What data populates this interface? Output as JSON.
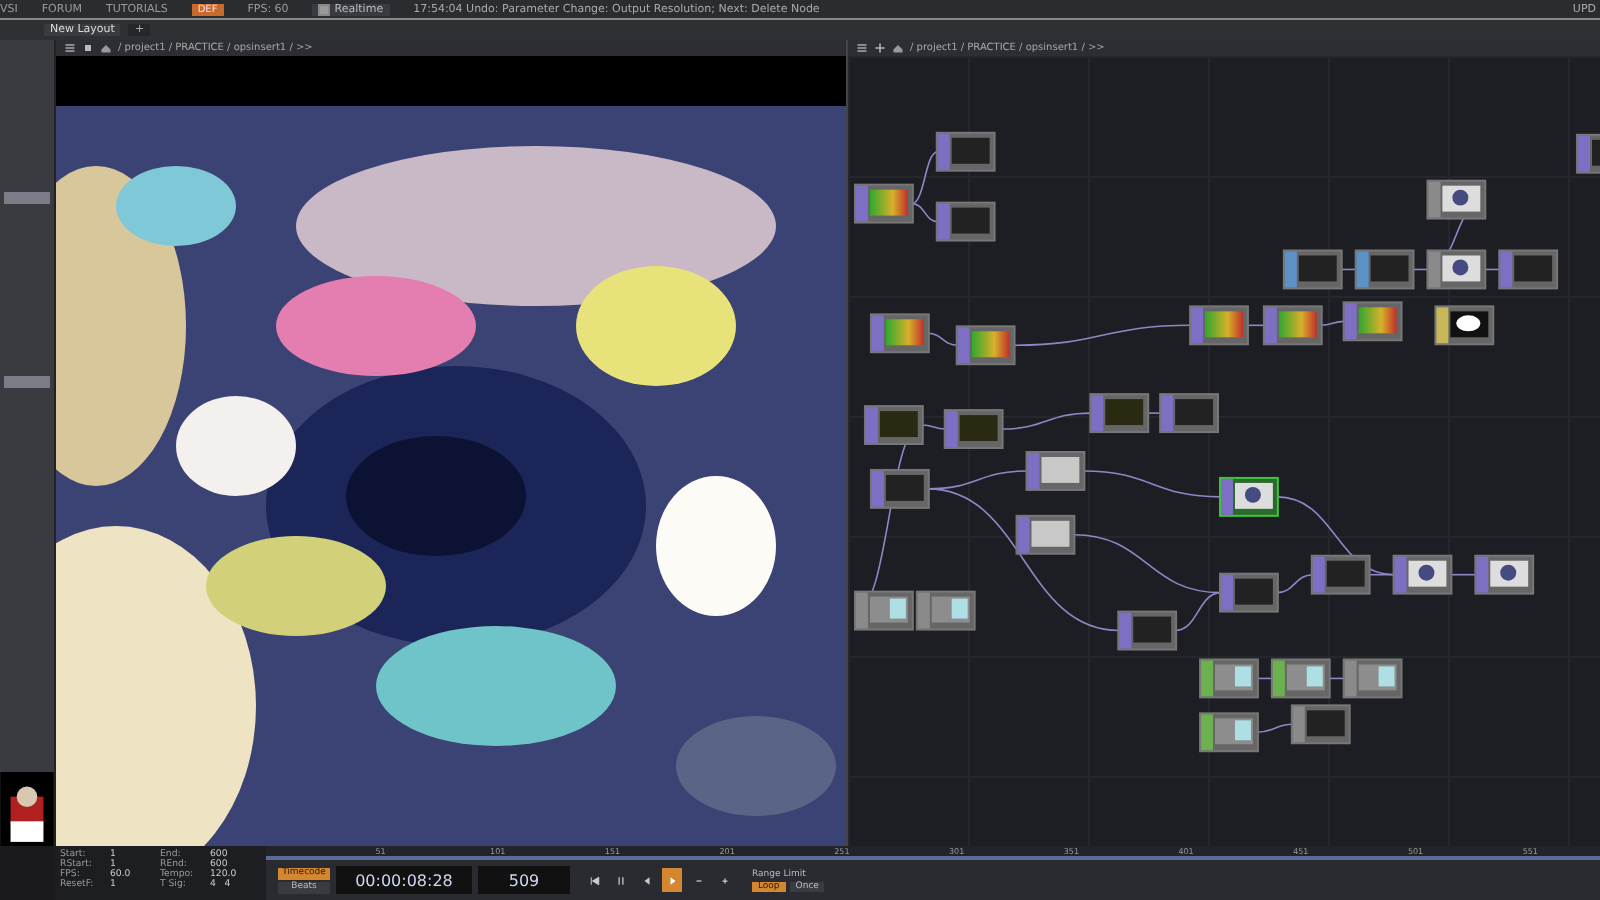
{
  "menubar": {
    "items": [
      "VSI",
      "FORUM",
      "TUTORIALS"
    ],
    "badge": "DEF",
    "fps": "FPS:  60",
    "realtime": {
      "label": "Realtime",
      "checked": true
    },
    "message": "17:54:04 Undo: Parameter Change: Output Resolution; Next: Delete Node",
    "right": "UPD"
  },
  "tabs": [
    {
      "label": "New Layout",
      "selected": true
    },
    {
      "label": "+",
      "selected": false
    }
  ],
  "viewer_path": "/ project1 / PRACTICE / opsinsert1 / >>",
  "network_path": "/ project1 / PRACTICE / opsinsert1 / >>",
  "nodes": [
    {
      "color": "#7d70c4",
      "kind": "gradient",
      "selected": false
    },
    {
      "color": "#7d70c4",
      "kind": "dark",
      "selected": false
    },
    {
      "color": "#7d70c4",
      "kind": "dark",
      "selected": false
    },
    {
      "color": "#7d70c4",
      "kind": "gradient",
      "selected": false
    },
    {
      "color": "#7d70c4",
      "kind": "gradient",
      "selected": false
    },
    {
      "color": "#7d70c4",
      "kind": "gradient",
      "selected": false
    },
    {
      "color": "#7d70c4",
      "kind": "gradient",
      "selected": false
    },
    {
      "color": "#7d70c4",
      "kind": "gradient",
      "selected": false
    },
    {
      "color": "#5b92c8",
      "kind": "dark",
      "selected": false
    },
    {
      "color": "#5b92c8",
      "kind": "dark",
      "selected": false
    },
    {
      "color": "#8a8a8a",
      "kind": "eye",
      "selected": false
    },
    {
      "color": "#8a8a8a",
      "kind": "eye",
      "selected": false
    },
    {
      "color": "#7d70c4",
      "kind": "dark",
      "selected": false
    },
    {
      "color": "#c9b85a",
      "kind": "ellipse",
      "selected": false
    },
    {
      "color": "#7d70c4",
      "kind": "dark",
      "selected": false
    },
    {
      "color": "#7d70c4",
      "kind": "noise",
      "selected": false
    },
    {
      "color": "#7d70c4",
      "kind": "noise",
      "selected": false
    },
    {
      "color": "#7d70c4",
      "kind": "noise",
      "selected": false
    },
    {
      "color": "#7d70c4",
      "kind": "dark",
      "selected": false
    },
    {
      "color": "#7d70c4",
      "kind": "dark",
      "selected": false
    },
    {
      "color": "#7d70c4",
      "kind": "white",
      "selected": false
    },
    {
      "color": "#7d70c4",
      "kind": "eye",
      "selected": true
    },
    {
      "color": "#7d70c4",
      "kind": "white",
      "selected": false
    },
    {
      "color": "#7d70c4",
      "kind": "dark",
      "selected": false
    },
    {
      "color": "#7d70c4",
      "kind": "dark",
      "selected": false
    },
    {
      "color": "#7d70c4",
      "kind": "eye",
      "selected": false
    },
    {
      "color": "#7d70c4",
      "kind": "eye",
      "selected": false
    },
    {
      "color": "#7d70c4",
      "kind": "dark",
      "selected": false
    },
    {
      "color": "#8a8a8a",
      "kind": "values",
      "selected": false
    },
    {
      "color": "#8a8a8a",
      "kind": "values",
      "selected": false
    },
    {
      "color": "#6cb04f",
      "kind": "values",
      "selected": false
    },
    {
      "color": "#6cb04f",
      "kind": "values",
      "selected": false
    },
    {
      "color": "#8a8a8a",
      "kind": "values",
      "selected": false
    },
    {
      "color": "#6cb04f",
      "kind": "values",
      "selected": false
    },
    {
      "color": "#8a8a8a",
      "kind": "dark",
      "selected": false
    }
  ],
  "time_settings": [
    {
      "label": "Start:",
      "value": "1"
    },
    {
      "label": "End:",
      "value": "600"
    },
    {
      "label": "RStart:",
      "value": "1"
    },
    {
      "label": "REnd:",
      "value": "600"
    },
    {
      "label": "FPS:",
      "value": "60.0"
    },
    {
      "label": "Tempo:",
      "value": "120.0"
    },
    {
      "label": "ResetF:",
      "value": "1"
    },
    {
      "label": "T Sig:",
      "value": "4   4"
    }
  ],
  "ruler_ticks": [
    "51",
    "101",
    "151",
    "201",
    "251",
    "301",
    "351",
    "401",
    "451",
    "501",
    "551"
  ],
  "time_modes": [
    {
      "label": "Timecode",
      "selected": true
    },
    {
      "label": "Beats",
      "selected": false
    }
  ],
  "timecode": "00:00:08:28",
  "frame": "509",
  "playing": true,
  "range_limit": {
    "label": "Range Limit",
    "options": [
      {
        "label": "Loop",
        "selected": true
      },
      {
        "label": "Once",
        "selected": false
      }
    ]
  }
}
